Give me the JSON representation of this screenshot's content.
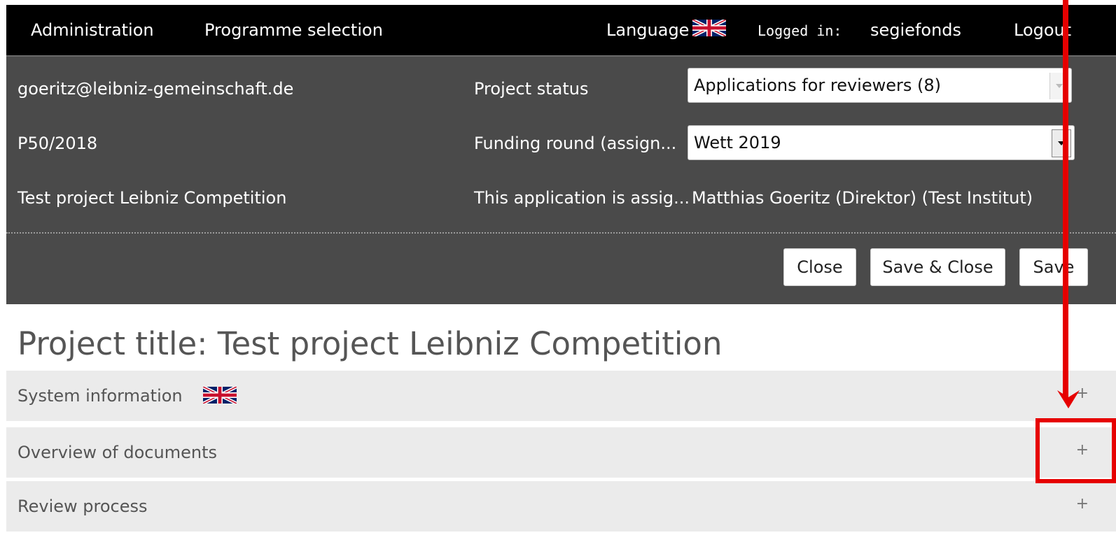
{
  "nav": {
    "administration": "Administration",
    "programme_selection": "Programme selection",
    "language_label": "Language",
    "logged_in_label": "Logged in:",
    "username": "segiefonds",
    "logout": "Logout"
  },
  "info": {
    "email": "goeritz@leibniz-gemeinschaft.de",
    "project_number": "P50/2018",
    "project_name": "Test project Leibniz Competition",
    "project_status_label": "Project status",
    "project_status_value": "Applications for reviewers (8)",
    "funding_round_label": "Funding round (assign...",
    "funding_round_value": "Wett 2019",
    "assigned_label": "This application is assig...",
    "assigned_value": "Matthias Goeritz (Direktor) (Test Institut)"
  },
  "buttons": {
    "close": "Close",
    "save_close": "Save & Close",
    "save": "Save"
  },
  "page_title": "Project title: Test project Leibniz Competition",
  "sections": [
    {
      "label": "System information",
      "toggle": "+"
    },
    {
      "label": "Overview of documents",
      "toggle": "+"
    },
    {
      "label": "Review process",
      "toggle": "+"
    }
  ],
  "icons": {
    "language_flag": "uk-flag-icon",
    "system_flag": "uk-flag-icon",
    "dropdown": "chevron-down-icon"
  },
  "colors": {
    "topbar_bg": "#000000",
    "panel_bg": "#4a4a4a",
    "section_bg": "#ebebeb",
    "annotation": "#e60000"
  }
}
